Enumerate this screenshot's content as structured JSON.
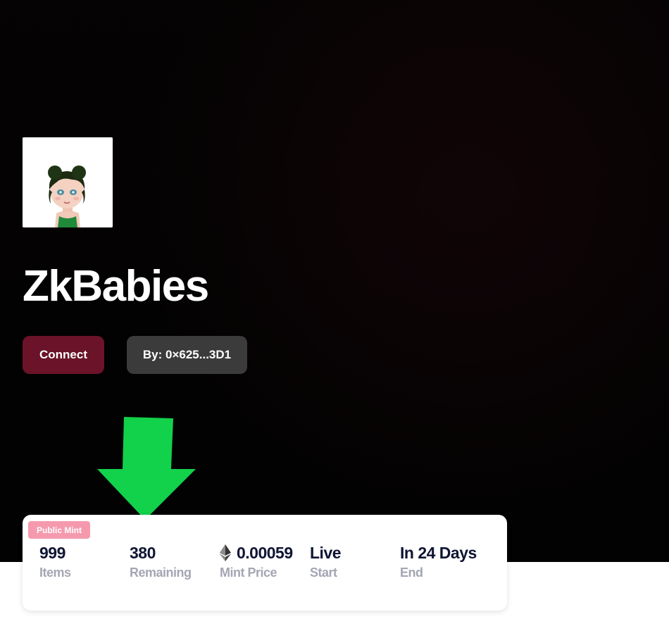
{
  "collection": {
    "title": "ZkBabies",
    "avatar_alt": "collection-avatar"
  },
  "actions": {
    "connect_label": "Connect",
    "creator_label": "By: 0×625...3D1"
  },
  "mint_card": {
    "phase_badge": "Public Mint",
    "stats": [
      {
        "value": "999",
        "label": "Items"
      },
      {
        "value": "380",
        "label": "Remaining"
      },
      {
        "value": "0.00059",
        "label": "Mint Price",
        "icon": "ethereum-icon"
      },
      {
        "value": "Live",
        "label": "Start"
      },
      {
        "value": "In 24 Days",
        "label": "End"
      }
    ]
  },
  "colors": {
    "hero_bg": "#020202",
    "connect_button": "#6b1328",
    "creator_button": "#3b3b3b",
    "badge": "#f59aae",
    "arrow": "#12d14b",
    "stat_value": "#0f1533",
    "stat_label": "#a4a6b3"
  }
}
